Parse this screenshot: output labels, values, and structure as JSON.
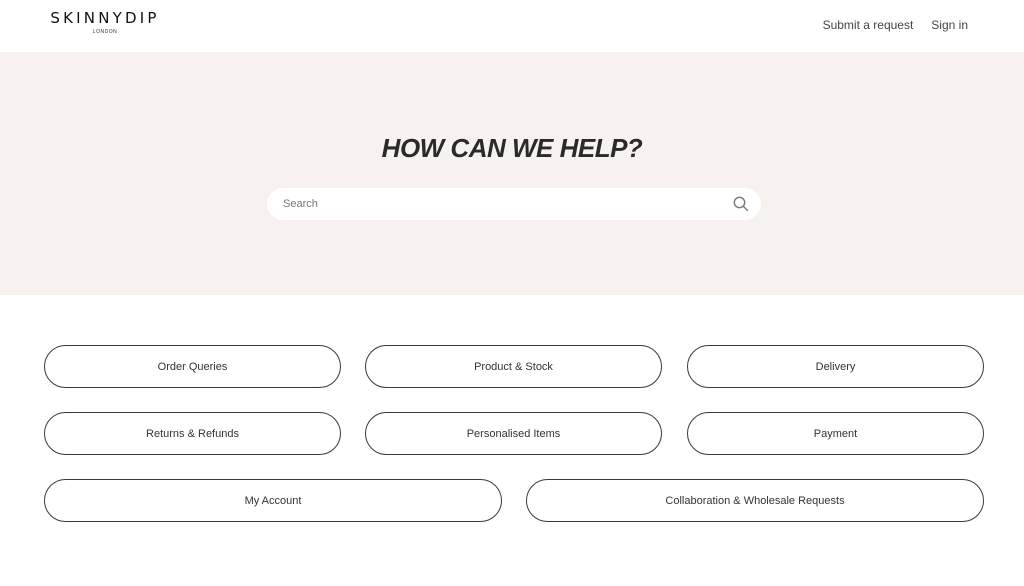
{
  "brand": {
    "name": "SKINNYDIP",
    "sub": "LONDON"
  },
  "nav": {
    "submit_request": "Submit a request",
    "sign_in": "Sign in"
  },
  "hero": {
    "title": "HOW CAN WE HELP?",
    "search_placeholder": "Search"
  },
  "categories": [
    "Order Queries",
    "Product & Stock",
    "Delivery",
    "Returns & Refunds",
    "Personalised Items",
    "Payment",
    "My Account",
    "Collaboration & Wholesale Requests"
  ],
  "colors": {
    "hero_bg": "#f7f2f0",
    "border": "#3a3a3a",
    "text": "#2b2b2b"
  }
}
